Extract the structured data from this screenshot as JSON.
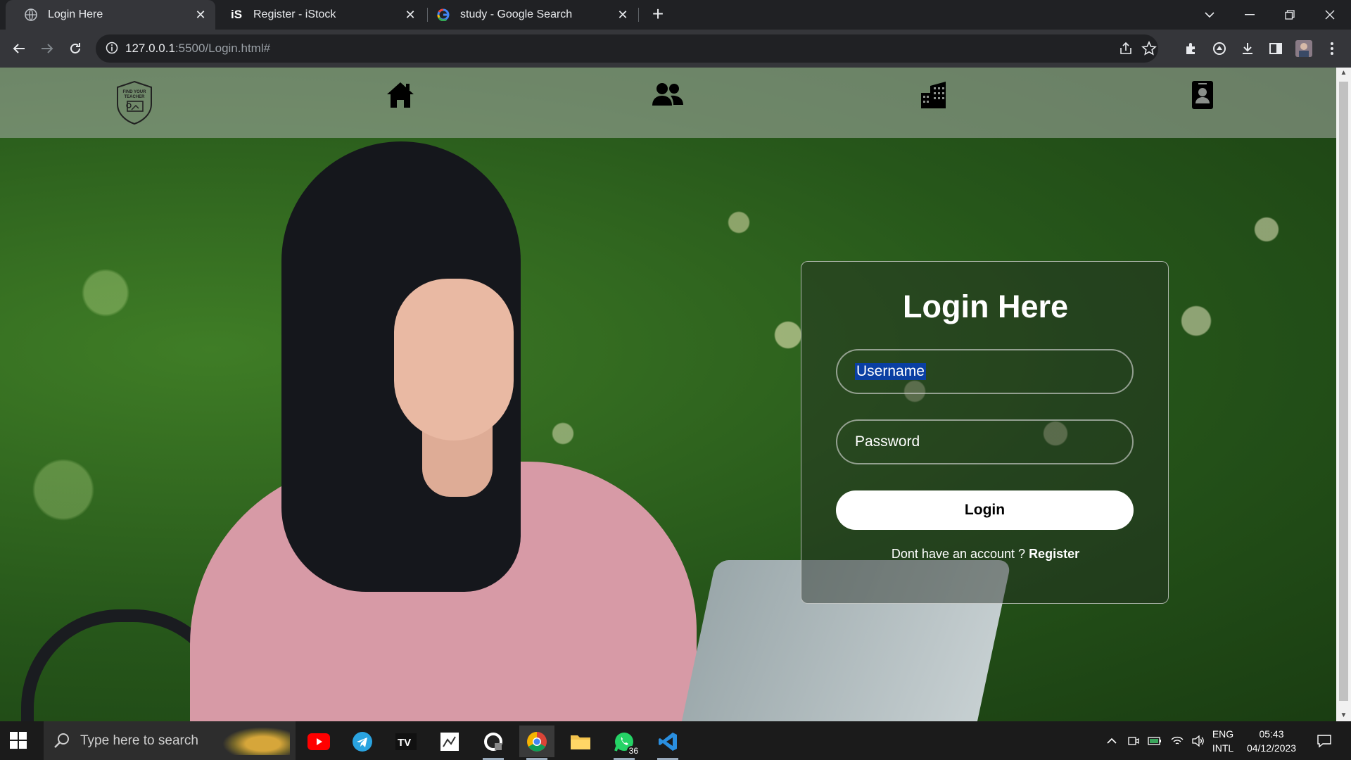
{
  "browser": {
    "tabs": [
      {
        "title": "Login Here",
        "favicon": "globe-icon",
        "active": true
      },
      {
        "title": "Register - iStock",
        "favicon": "istock-icon",
        "active": false
      },
      {
        "title": "study - Google Search",
        "favicon": "google-icon",
        "active": false
      }
    ],
    "url_host": "127.0.0.1",
    "url_rest": ":5500/Login.html#"
  },
  "site": {
    "logo_text": "FIND YOUR TEACHER",
    "nav_icons": [
      "home-icon",
      "users-icon",
      "building-icon",
      "contact-icon"
    ]
  },
  "login": {
    "title": "Login Here",
    "username_value": "Username",
    "password_value": "Password",
    "button_label": "Login",
    "register_prompt": "Dont have an account ?",
    "register_link": "Register"
  },
  "taskbar": {
    "search_placeholder": "Type here to search",
    "whatsapp_badge": "36",
    "lang_line1": "ENG",
    "lang_line2": "INTL",
    "time": "05:43",
    "date": "04/12/2023"
  },
  "colors": {
    "chrome_dark": "#202124",
    "chrome_toolbar": "#35363a",
    "selection": "#0a3fa3"
  }
}
